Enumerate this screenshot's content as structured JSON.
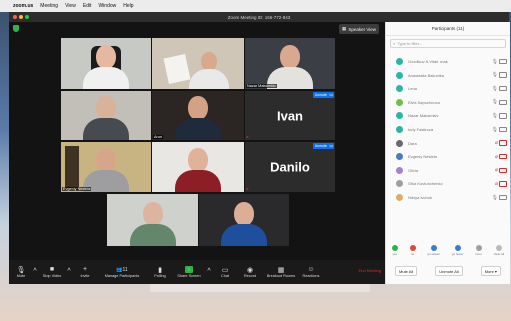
{
  "menubar": {
    "app": "zoom.us",
    "items": [
      "Meeting",
      "View",
      "Edit",
      "Window",
      "Help"
    ]
  },
  "window": {
    "title": "Zoom Meeting ID: 166-772-843"
  },
  "top": {
    "speaker_view": "Speaker View"
  },
  "tiles": [
    {
      "name": "",
      "label": "",
      "kind": "video"
    },
    {
      "name": "",
      "label": "",
      "kind": "video"
    },
    {
      "name": "Nazar Maksimkiv",
      "label": "",
      "kind": "video"
    },
    {
      "name": "",
      "label": "",
      "kind": "video"
    },
    {
      "name": "Arun",
      "label": "",
      "kind": "video"
    },
    {
      "name": "",
      "label": "Ivan",
      "kind": "name",
      "unmute": "Unmute"
    },
    {
      "name": "Evgeniy Nestiria",
      "label": "",
      "kind": "video"
    },
    {
      "name": "",
      "label": "",
      "kind": "video"
    },
    {
      "name": "",
      "label": "Danilo",
      "kind": "name",
      "unmute": "Unmute"
    },
    {
      "name": "",
      "label": "",
      "kind": "video"
    },
    {
      "name": "",
      "label": "",
      "kind": "video"
    }
  ],
  "toolbar": {
    "items": [
      "Mute",
      "Stop Video",
      "Invite",
      "Manage Participants",
      "Polling",
      "Share Screen",
      "Chat",
      "Record",
      "Breakout Rooms",
      "Reactions"
    ],
    "participants_count": "11",
    "end": "End Meeting"
  },
  "panel": {
    "title": "Participants (11)",
    "search_placeholder": "Type to filter...",
    "participants": [
      {
        "name": "Gozdikov A.Vitali. mak",
        "color": "#2bb5a4",
        "muted": false
      },
      {
        "name": "Anastasiia Bakunika",
        "color": "#2bb5a4",
        "muted": false
      },
      {
        "name": "Lena",
        "color": "#2bb5a4",
        "muted": false
      },
      {
        "name": "Elvis Sapozhnova",
        "color": "#6fbf4f",
        "muted": false
      },
      {
        "name": "Nazar Maksimkiv",
        "color": "#2bb5a4",
        "muted": false
      },
      {
        "name": "Iuriy Fastiroza",
        "color": "#2bb5a4",
        "muted": false
      },
      {
        "name": "Dara",
        "color": "#6b6b6b",
        "muted": true
      },
      {
        "name": "Evgeniy Nestiria",
        "color": "#4a7ac6",
        "muted": true
      },
      {
        "name": "Olivia",
        "color": "#a77ed9",
        "muted": true
      },
      {
        "name": "Olka Kovtunchenko",
        "color": "#9aa0a6",
        "muted": true
      },
      {
        "name": "Nikrya Ivchuk",
        "color": "#d4b06a",
        "muted": false
      }
    ],
    "reactions": [
      "yes",
      "no",
      "go slower",
      "go faster",
      "more",
      "clear all"
    ],
    "buttons": {
      "mute_all": "Mute All",
      "unmute_all": "Unmute All",
      "more": "More"
    }
  }
}
